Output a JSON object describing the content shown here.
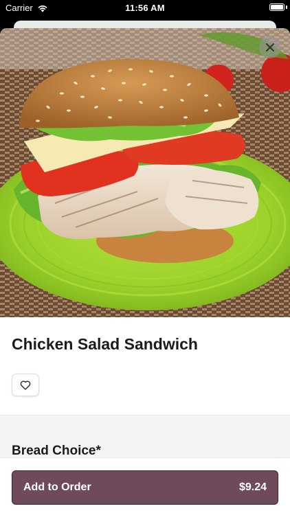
{
  "status_bar": {
    "carrier": "Carrier",
    "time": "11:56 AM",
    "battery_level": 1.0
  },
  "item": {
    "name": "Chicken Salad Sandwich",
    "image_icon": "sandwich-photo"
  },
  "actions": {
    "close_icon": "close-icon",
    "favorite_icon": "heart-icon"
  },
  "options": {
    "section_title": "Bread Choice*"
  },
  "order": {
    "label": "Add to Order",
    "price": "$9.24"
  },
  "colors": {
    "accent": "#6f4a5b",
    "accent_border": "#3d2430",
    "title_text": "#1b1b1f",
    "section_bg": "#f4f4f5"
  }
}
